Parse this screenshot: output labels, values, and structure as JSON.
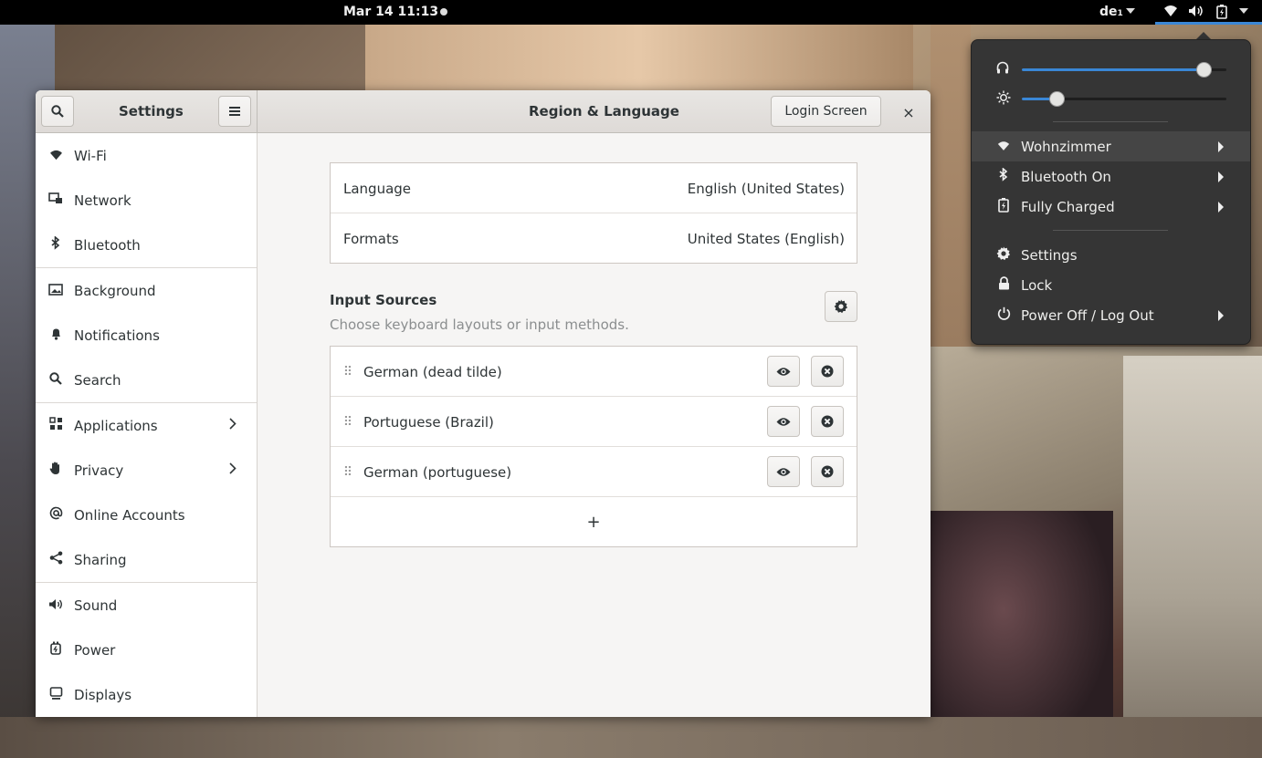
{
  "topbar": {
    "clock": "Mar 14  11:13",
    "keyboard_layout": "de",
    "keyboard_layout_index": "1"
  },
  "window": {
    "sidebar_title": "Settings",
    "page_title": "Region & Language",
    "login_screen_label": "Login Screen",
    "close_glyph": "×"
  },
  "sidebar": {
    "items": [
      {
        "label": "Wi-Fi",
        "icon": "wifi-icon",
        "glyph": "📶"
      },
      {
        "label": "Network",
        "icon": "network-icon",
        "glyph": "🖧"
      },
      {
        "label": "Bluetooth",
        "icon": "bluetooth-icon",
        "glyph": "ᛒ"
      },
      {
        "label": "Background",
        "icon": "background-icon",
        "glyph": "🖼"
      },
      {
        "label": "Notifications",
        "icon": "bell-icon",
        "glyph": "🔔"
      },
      {
        "label": "Search",
        "icon": "search-icon",
        "glyph": "⚲"
      },
      {
        "label": "Applications",
        "icon": "apps-grid-icon",
        "glyph": "▦"
      },
      {
        "label": "Privacy",
        "icon": "hand-icon",
        "glyph": "✋"
      },
      {
        "label": "Online Accounts",
        "icon": "at-icon",
        "glyph": "@"
      },
      {
        "label": "Sharing",
        "icon": "share-icon",
        "glyph": "⋖"
      },
      {
        "label": "Sound",
        "icon": "speaker-icon",
        "glyph": "🔈"
      },
      {
        "label": "Power",
        "icon": "power-icon",
        "glyph": "🔌"
      },
      {
        "label": "Displays",
        "icon": "display-icon",
        "glyph": "▭"
      }
    ]
  },
  "region": {
    "language_label": "Language",
    "language_value": "English (United States)",
    "formats_label": "Formats",
    "formats_value": "United States (English)"
  },
  "input_sources": {
    "heading": "Input Sources",
    "description": "Choose keyboard layouts or input methods.",
    "sources": [
      {
        "name": "German (dead tilde)"
      },
      {
        "name": "Portuguese (Brazil)"
      },
      {
        "name": "German (portuguese)"
      }
    ],
    "add_glyph": "+"
  },
  "system_menu": {
    "volume_level": 0.89,
    "brightness_level": 0.17,
    "items": [
      {
        "label": "Wohnzimmer",
        "icon": "wifi-icon"
      },
      {
        "label": "Bluetooth On",
        "icon": "bluetooth-icon"
      },
      {
        "label": "Fully Charged",
        "icon": "battery-icon"
      },
      {
        "label": "Settings",
        "icon": "gear-icon"
      },
      {
        "label": "Lock",
        "icon": "lock-icon"
      },
      {
        "label": "Power Off / Log Out",
        "icon": "power-icon"
      }
    ]
  },
  "colors": {
    "accent": "#3a87d6",
    "menu_bg": "#353535",
    "window_bg": "#f6f5f4"
  }
}
